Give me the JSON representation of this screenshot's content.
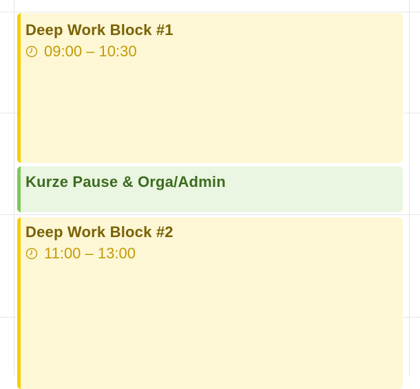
{
  "events": [
    {
      "title": "Deep Work Block #1",
      "time": "09:00 – 10:30",
      "color": "#f3cd08",
      "icon": "clock-icon"
    },
    {
      "title": "Kurze Pause & Orga/Admin",
      "color": "#7dc959"
    },
    {
      "title": "Deep Work Block #2",
      "time": "11:00 – 13:00",
      "color": "#f3cd08",
      "icon": "clock-icon"
    }
  ]
}
